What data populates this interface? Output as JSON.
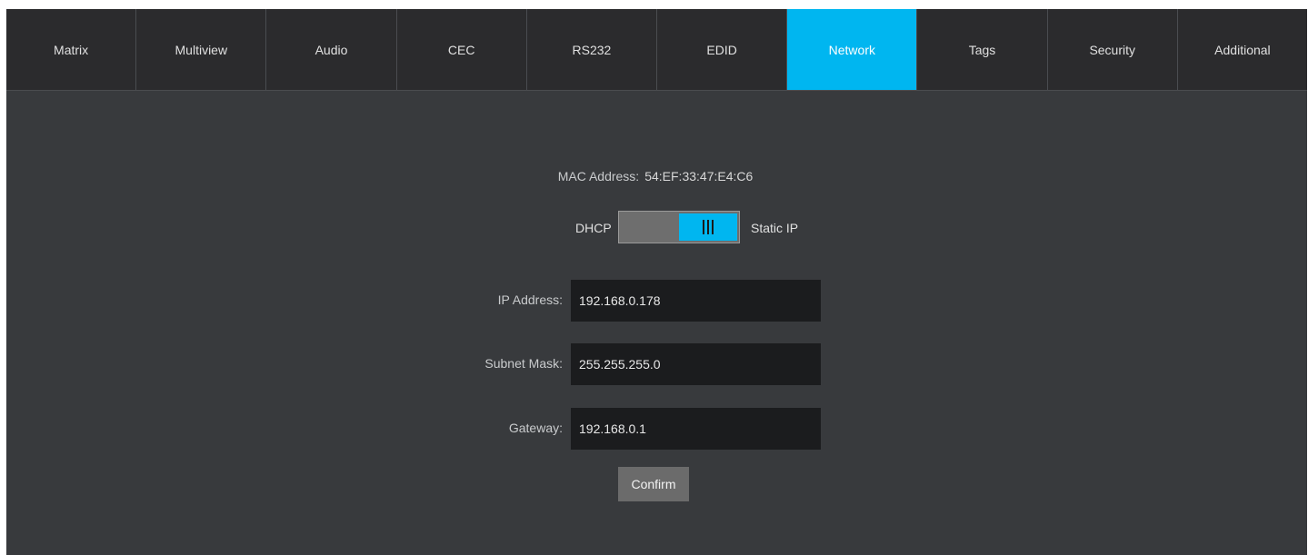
{
  "tabs": [
    {
      "label": "Matrix"
    },
    {
      "label": "Multiview"
    },
    {
      "label": "Audio"
    },
    {
      "label": "CEC"
    },
    {
      "label": "RS232"
    },
    {
      "label": "EDID"
    },
    {
      "label": "Network"
    },
    {
      "label": "Tags"
    },
    {
      "label": "Security"
    },
    {
      "label": "Additional"
    }
  ],
  "active_tab": "Network",
  "network": {
    "mac_label": "MAC Address:",
    "mac_value": "54:EF:33:47:E4:C6",
    "mode_left_label": "DHCP",
    "mode_right_label": "Static IP",
    "mode_selected": "Static IP",
    "ip_label": "IP Address:",
    "ip_value": "192.168.0.178",
    "subnet_label": "Subnet Mask:",
    "subnet_value": "255.255.255.0",
    "gateway_label": "Gateway:",
    "gateway_value": "192.168.0.1",
    "confirm_label": "Confirm"
  },
  "colors": {
    "accent": "#00b6f0",
    "tab_bar": "#2b2b2d",
    "content_bg": "#383a3d",
    "input_bg": "#1b1c1e",
    "button_bg": "#6b6b6b"
  }
}
